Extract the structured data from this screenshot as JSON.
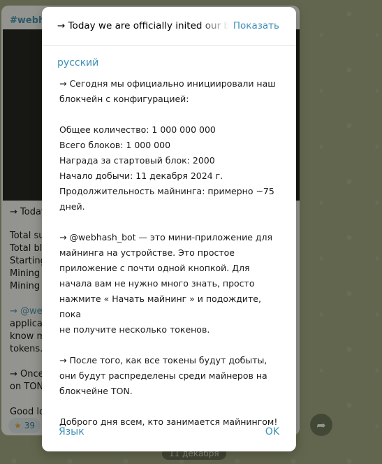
{
  "chat": {
    "channel": "#webha",
    "message_lines": [
      "→ Today",
      "Total su",
      "Total blo",
      "Starting",
      "Mining S",
      "Mining d",
      "→ @web",
      "applicat",
      "know m",
      "tokens.",
      "→ Once",
      "on TON",
      "Good lo"
    ],
    "reaction_count": "39",
    "reaction_icon": "star-icon",
    "date_label": "11 декабря"
  },
  "dialog": {
    "original_text": "→ Today we are officially inited our blockchain",
    "show_label": "Показать",
    "language": "русский",
    "paragraphs": [
      "→ Сегодня мы официально инициировали наш\nблокчейн с конфигурацией:",
      "Общее количество: 1 000 000 000\nВсего блоков: 1 000 000\nНаграда за стартовый блок: 2000\nНачало добычи: 11 декабря 2024 г.\nПродолжительность майнинга: примерно ~75\nдней.",
      "→ @webhash_bot — это мини-приложение для\nмайнинга на устройстве. Это простое\nприложение с почти одной кнопкой. Для\nначала вам не нужно много знать, просто\nнажмите « Начать майнинг » и подождите, пока\nне получите несколько токенов.",
      "→ После того, как все токены будут добыты,\nони будут распределены среди майнеров на\nблокчейне TON.",
      "Доброго дня всем, кто занимается майнингом!"
    ],
    "language_button": "Язык",
    "ok_button": "OK"
  },
  "colors": {
    "accent": "#3d8fb6",
    "dialog_bg": "#ffffff",
    "overlay": "#7b7f65"
  }
}
